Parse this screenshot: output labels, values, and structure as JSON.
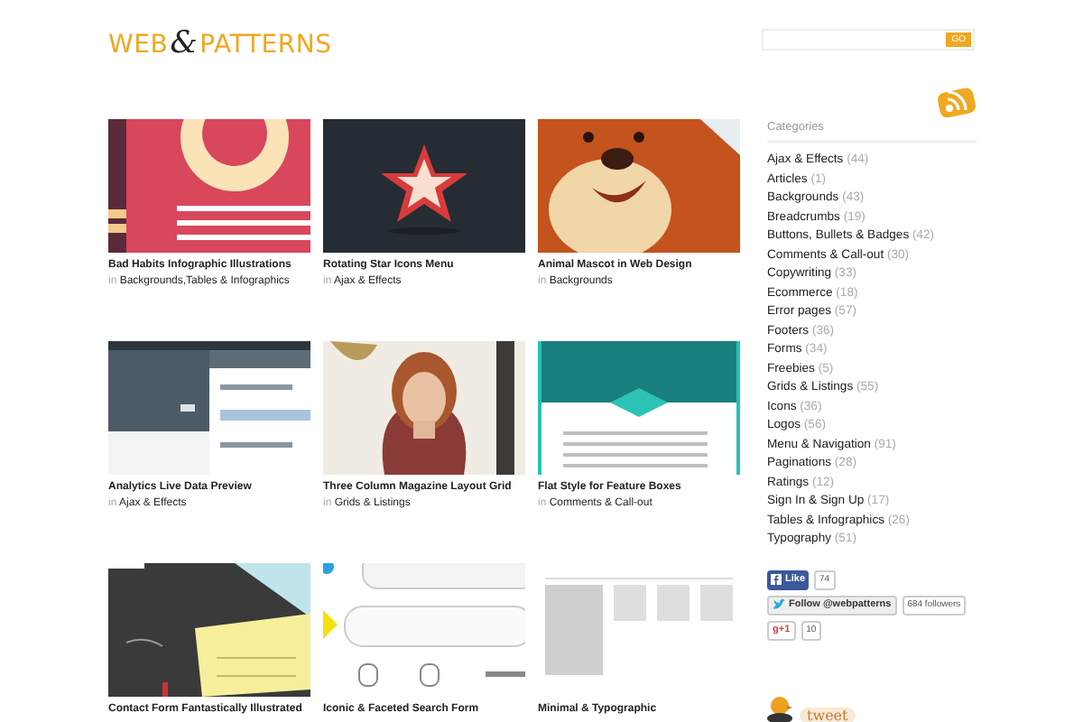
{
  "logo": {
    "left": "WEB",
    "amp": "&",
    "right": "PATTERNS"
  },
  "search": {
    "button": "GO"
  },
  "posts": [
    {
      "title": "Bad Habits Infographic Illustrations",
      "prefix": "in",
      "category": "Backgrounds,Tables & Infographics"
    },
    {
      "title": "Rotating Star Icons Menu",
      "prefix": "in",
      "category": "Ajax & Effects"
    },
    {
      "title": "Animal Mascot in Web Design",
      "prefix": "in",
      "category": "Backgrounds"
    },
    {
      "title": "Analytics Live Data Preview",
      "prefix": "in",
      "category": "Ajax & Effects"
    },
    {
      "title": "Three Column Magazine Layout Grid",
      "prefix": "in",
      "category": "Grids & Listings"
    },
    {
      "title": "Flat Style for Feature Boxes",
      "prefix": "in",
      "category": "Comments & Call-out"
    },
    {
      "title": "Contact Form Fantastically Illustrated"
    },
    {
      "title": "Iconic & Faceted Search Form"
    },
    {
      "title": "Minimal & Typographic"
    }
  ],
  "sidebar": {
    "heading": "Categories",
    "categories": [
      {
        "name": "Ajax & Effects",
        "count": "(44)"
      },
      {
        "name": "Articles",
        "count": "(1)"
      },
      {
        "name": "Backgrounds",
        "count": "(43)"
      },
      {
        "name": "Breadcrumbs",
        "count": "(19)"
      },
      {
        "name": "Buttons, Bullets & Badges",
        "count": "(42)"
      },
      {
        "name": "Comments & Call-out",
        "count": "(30)"
      },
      {
        "name": "Copywriting",
        "count": "(33)"
      },
      {
        "name": "Ecommerce",
        "count": "(18)"
      },
      {
        "name": "Error pages",
        "count": "(57)"
      },
      {
        "name": "Footers",
        "count": "(36)"
      },
      {
        "name": "Forms",
        "count": "(34)"
      },
      {
        "name": "Freebies",
        "count": "(5)"
      },
      {
        "name": "Grids & Listings",
        "count": "(55)"
      },
      {
        "name": "Icons",
        "count": "(36)"
      },
      {
        "name": "Logos",
        "count": "(56)"
      },
      {
        "name": "Menu & Navigation",
        "count": "(91)"
      },
      {
        "name": "Paginations",
        "count": "(28)"
      },
      {
        "name": "Ratings",
        "count": "(12)"
      },
      {
        "name": "Sign In & Sign Up",
        "count": "(17)"
      },
      {
        "name": "Tables & Infographics",
        "count": "(26)"
      },
      {
        "name": "Typography",
        "count": "(51)"
      }
    ],
    "social": [
      {
        "kind": "facebook",
        "label": "Like",
        "count": "74"
      },
      {
        "kind": "twitter",
        "label": "Follow @webpatterns",
        "count": "684 followers"
      },
      {
        "kind": "google",
        "label": "g+1",
        "count": "10"
      }
    ],
    "tweet": "tweet"
  }
}
